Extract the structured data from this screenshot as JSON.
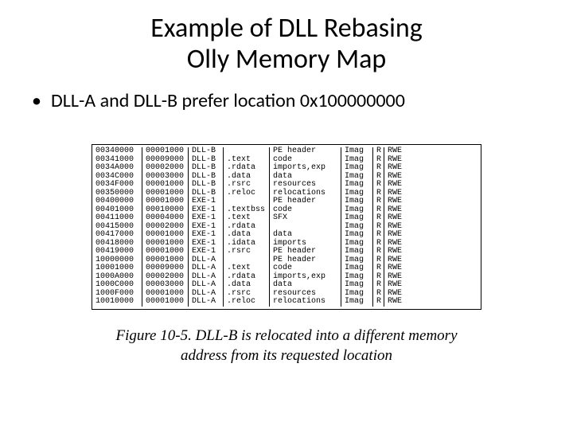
{
  "title_line1": "Example of DLL Rebasing",
  "title_line2": "Olly Memory Map",
  "bullet_text": "DLL-A and DLL-B prefer location 0x100000000",
  "caption_line1": "Figure 10-5. DLL-B is relocated into a different memory",
  "caption_line2": "address from its requested location",
  "rows": [
    {
      "addr": "00340000",
      "size": "00001000",
      "own": "DLL-B",
      "sec": "",
      "desc": "PE header",
      "type": "Imag",
      "acc": "R",
      "init": "RWE"
    },
    {
      "addr": "00341000",
      "size": "00009000",
      "own": "DLL-B",
      "sec": ".text",
      "desc": "code",
      "type": "Imag",
      "acc": "R",
      "init": "RWE"
    },
    {
      "addr": "0034A000",
      "size": "00002000",
      "own": "DLL-B",
      "sec": ".rdata",
      "desc": "imports,exp",
      "type": "Imag",
      "acc": "R",
      "init": "RWE"
    },
    {
      "addr": "0034C000",
      "size": "00003000",
      "own": "DLL-B",
      "sec": ".data",
      "desc": "data",
      "type": "Imag",
      "acc": "R",
      "init": "RWE"
    },
    {
      "addr": "0034F000",
      "size": "00001000",
      "own": "DLL-B",
      "sec": ".rsrc",
      "desc": "resources",
      "type": "Imag",
      "acc": "R",
      "init": "RWE"
    },
    {
      "addr": "00350000",
      "size": "00001000",
      "own": "DLL-B",
      "sec": ".reloc",
      "desc": "relocations",
      "type": "Imag",
      "acc": "R",
      "init": "RWE"
    },
    {
      "addr": "00400000",
      "size": "00001000",
      "own": "EXE-1",
      "sec": "",
      "desc": "PE header",
      "type": "Imag",
      "acc": "R",
      "init": "RWE"
    },
    {
      "addr": "00401000",
      "size": "00010000",
      "own": "EXE-1",
      "sec": ".textbss",
      "desc": "code",
      "type": "Imag",
      "acc": "R",
      "init": "RWE"
    },
    {
      "addr": "00411000",
      "size": "00004000",
      "own": "EXE-1",
      "sec": ".text",
      "desc": "SFX",
      "type": "Imag",
      "acc": "R",
      "init": "RWE"
    },
    {
      "addr": "00415000",
      "size": "00002000",
      "own": "EXE-1",
      "sec": ".rdata",
      "desc": "",
      "type": "Imag",
      "acc": "R",
      "init": "RWE"
    },
    {
      "addr": "00417000",
      "size": "00001000",
      "own": "EXE-1",
      "sec": ".data",
      "desc": "data",
      "type": "Imag",
      "acc": "R",
      "init": "RWE"
    },
    {
      "addr": "00418000",
      "size": "00001000",
      "own": "EXE-1",
      "sec": ".idata",
      "desc": "imports",
      "type": "Imag",
      "acc": "R",
      "init": "RWE"
    },
    {
      "addr": "00419000",
      "size": "00001000",
      "own": "EXE-1",
      "sec": ".rsrc",
      "desc": "PE header",
      "type": "Imag",
      "acc": "R",
      "init": "RWE"
    },
    {
      "addr": "10000000",
      "size": "00001000",
      "own": "DLL-A",
      "sec": "",
      "desc": "PE header",
      "type": "Imag",
      "acc": "R",
      "init": "RWE"
    },
    {
      "addr": "10001000",
      "size": "00009000",
      "own": "DLL-A",
      "sec": ".text",
      "desc": "code",
      "type": "Imag",
      "acc": "R",
      "init": "RWE"
    },
    {
      "addr": "1000A000",
      "size": "00002000",
      "own": "DLL-A",
      "sec": ".rdata",
      "desc": "imports,exp",
      "type": "Imag",
      "acc": "R",
      "init": "RWE"
    },
    {
      "addr": "1000C000",
      "size": "00003000",
      "own": "DLL-A",
      "sec": ".data",
      "desc": "data",
      "type": "Imag",
      "acc": "R",
      "init": "RWE"
    },
    {
      "addr": "1000F000",
      "size": "00001000",
      "own": "DLL-A",
      "sec": ".rsrc",
      "desc": "resources",
      "type": "Imag",
      "acc": "R",
      "init": "RWE"
    },
    {
      "addr": "10010000",
      "size": "00001000",
      "own": "DLL-A",
      "sec": ".reloc",
      "desc": "relocations",
      "type": "Imag",
      "acc": "R",
      "init": "RWE"
    }
  ]
}
